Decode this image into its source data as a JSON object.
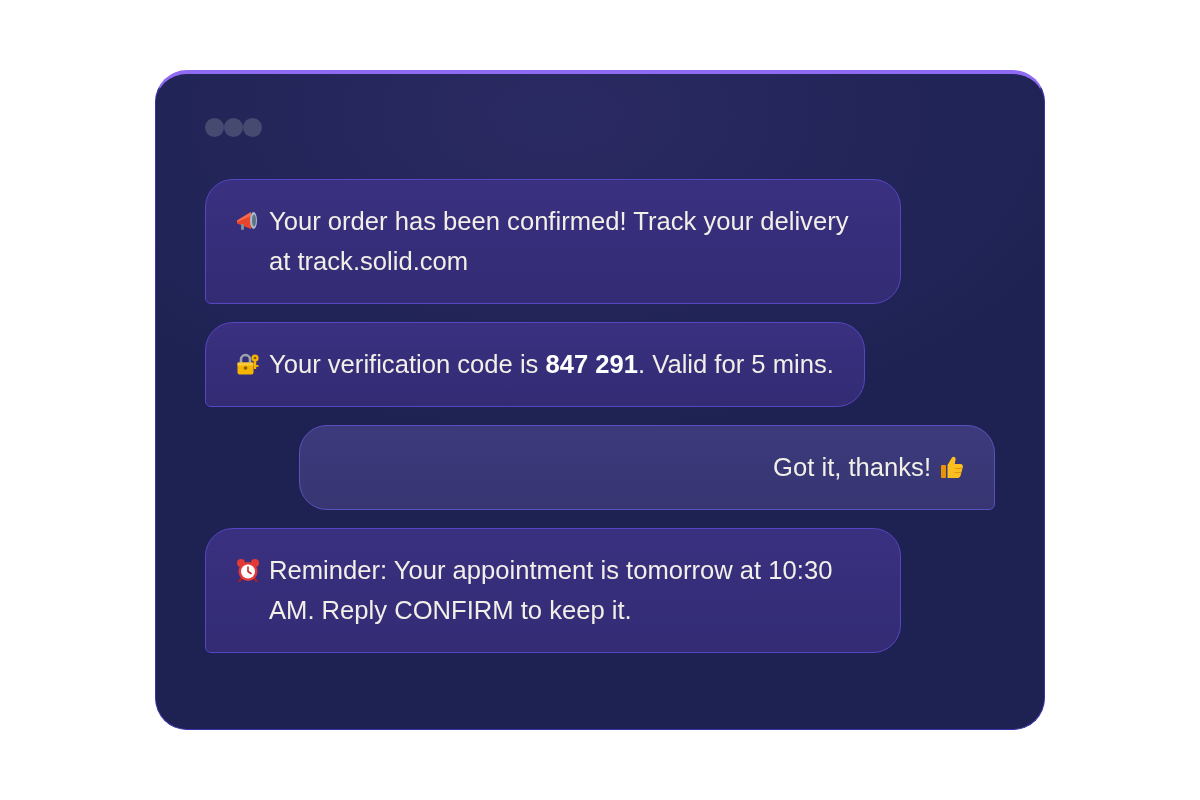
{
  "messages": [
    {
      "kind": "incoming",
      "text": "Your order has been confirmed! Track your delivery at track.solid.com"
    },
    {
      "kind": "incoming",
      "text": "Your verification code is **847 291**. Valid for 5 mins."
    },
    {
      "kind": "outgoing",
      "text": "Got it, thanks!"
    },
    {
      "kind": "incoming",
      "text": "Reminder: Your appointment is tomorrow at 10:30 AM. Reply CONFIRM to keep it."
    }
  ]
}
